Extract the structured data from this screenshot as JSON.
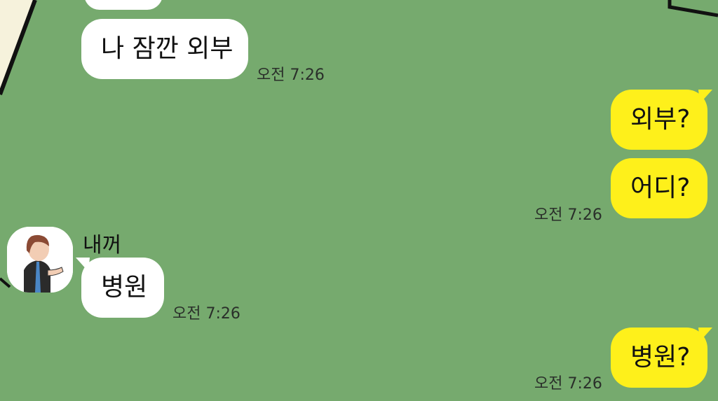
{
  "chat": {
    "messages": [
      {
        "text": "나 잠깐 외부",
        "time": "오전 7:26"
      },
      {
        "text": "외부?"
      },
      {
        "text": "어디?",
        "time": "오전 7:26"
      },
      {
        "sender": "내꺼",
        "text": "병원",
        "time": "오전 7:26"
      },
      {
        "text": "병원?",
        "time": "오전 7:26"
      }
    ]
  },
  "colors": {
    "background": "#76aa6e",
    "incoming_bubble": "#ffffff",
    "outgoing_bubble": "#fef01b"
  },
  "icons": [
    "avatar-icon"
  ]
}
